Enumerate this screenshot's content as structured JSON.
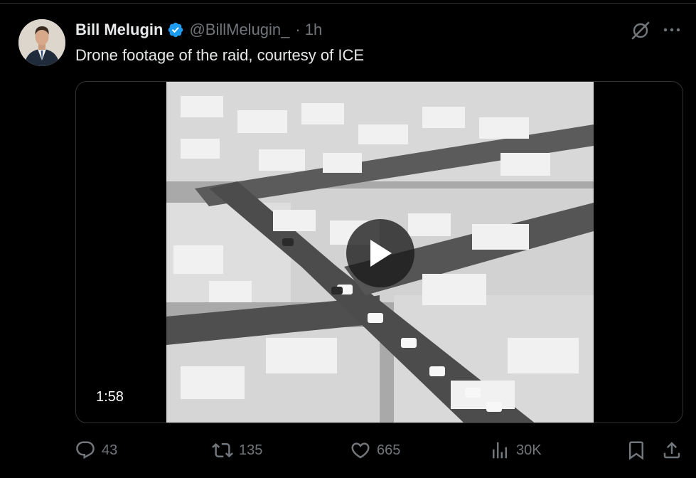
{
  "author": {
    "display_name": "Bill Melugin",
    "handle": "@BillMelugin_",
    "time": "1h",
    "separator": "·"
  },
  "tweet": {
    "text": "Drone footage of the raid, courtesy of ICE"
  },
  "media": {
    "type": "video",
    "duration": "1:58"
  },
  "actions": {
    "reply_count": "43",
    "repost_count": "135",
    "like_count": "665",
    "view_count": "30K"
  },
  "colors": {
    "background": "#000000",
    "text": "#e7e9ea",
    "muted": "#71767b",
    "verified": "#1d9bf0",
    "border": "#2f3336"
  },
  "icons": [
    "verified-badge-icon",
    "grok-icon",
    "more-icon",
    "play-icon",
    "reply-icon",
    "repost-icon",
    "like-icon",
    "views-icon",
    "bookmark-icon",
    "share-icon"
  ]
}
